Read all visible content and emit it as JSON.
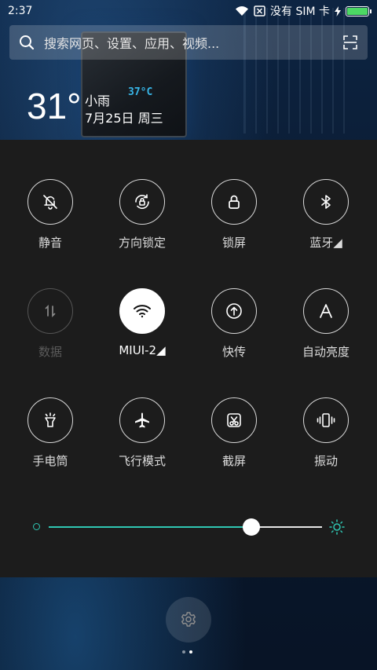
{
  "status_bar": {
    "time": "2:37",
    "sim_text": "没有 SIM 卡",
    "battery_color": "#4cd964"
  },
  "wallpaper": {
    "chip_label": "37°C"
  },
  "search": {
    "placeholder": "搜索网页、设置、应用、视频...",
    "icon": "search-icon",
    "scan_icon": "scan-icon"
  },
  "weather": {
    "temperature": "31°",
    "condition": "小雨",
    "date": "7月25日 周三"
  },
  "tiles": [
    {
      "label": "静音",
      "icon": "bell-off-icon",
      "state": "off"
    },
    {
      "label": "方向锁定",
      "icon": "rotation-lock-icon",
      "state": "off"
    },
    {
      "label": "锁屏",
      "icon": "lock-icon",
      "state": "off"
    },
    {
      "label": "蓝牙◢",
      "icon": "bluetooth-icon",
      "state": "off"
    },
    {
      "label": "数据",
      "icon": "mobile-data-icon",
      "state": "disabled"
    },
    {
      "label": "MIUI-2◢",
      "icon": "wifi-icon",
      "state": "on"
    },
    {
      "label": "快传",
      "icon": "quick-share-icon",
      "state": "off"
    },
    {
      "label": "自动亮度",
      "icon": "auto-brightness-icon",
      "state": "off"
    },
    {
      "label": "手电筒",
      "icon": "flashlight-icon",
      "state": "off"
    },
    {
      "label": "飞行模式",
      "icon": "airplane-icon",
      "state": "off"
    },
    {
      "label": "截屏",
      "icon": "screenshot-icon",
      "state": "off"
    },
    {
      "label": "振动",
      "icon": "vibrate-icon",
      "state": "off"
    }
  ],
  "brightness": {
    "level": 0.74,
    "accent": "#2fc6b2"
  },
  "pager": {
    "pages": 2,
    "current": 2
  }
}
